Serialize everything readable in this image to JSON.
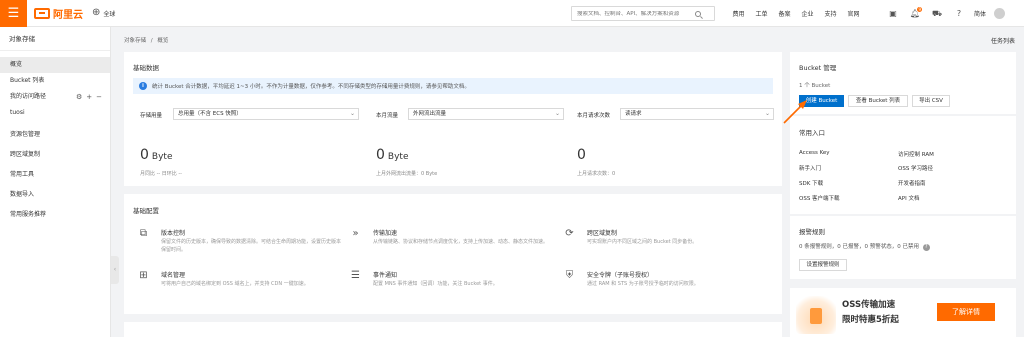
{
  "topbar": {
    "brand": "阿里云",
    "region": "全球",
    "search_placeholder": "搜索文档、控制台、API、解决方案和资源",
    "nav": [
      "费用",
      "工单",
      "备案",
      "企业",
      "支持",
      "官网"
    ],
    "notification_count": "9",
    "language": "简体"
  },
  "sidebar": {
    "title": "对象存储",
    "items": [
      {
        "label": "概览",
        "active": true
      },
      {
        "label": "Bucket 列表"
      },
      {
        "label": "我的访问路径"
      },
      {
        "label": "tuosi"
      },
      {
        "label": "资源包管理"
      },
      {
        "label": "跨区域复制"
      },
      {
        "label": "常用工具"
      },
      {
        "label": "数据导入"
      },
      {
        "label": "常用服务推荐"
      }
    ],
    "access_path_actions": [
      "⚙",
      "+",
      "−"
    ]
  },
  "breadcrumb": [
    "对象存储",
    "/",
    "概览"
  ],
  "task_list": "任务列表",
  "basic_data": {
    "title": "基础数据",
    "notice": "统计 Bucket 合计数据，平均延迟 1~3 小时。不作为计量数据，仅作参考。不同存储类型的存储用量计费规则，请参见帮助文档。",
    "metrics": [
      {
        "label": "存储用量",
        "select": "总用量（不含 ECS 快照）",
        "value": "0",
        "unit": "Byte",
        "sub": "月同比  --  日环比  --"
      },
      {
        "label": "本月流量",
        "select": "外网流出流量",
        "value": "0",
        "unit": "Byte",
        "sub": "上月外网流出流量：0 Byte"
      },
      {
        "label": "本月请求次数",
        "select": "读请求",
        "value": "0",
        "unit": "",
        "sub": "上月请求次数：0"
      }
    ]
  },
  "basic_config": {
    "title": "基础配置",
    "features": [
      {
        "icon": "version-control-icon",
        "glyph": "⧉",
        "title": "版本控制",
        "desc": "保留文件的历史版本，确保导致的数据清除。可结合生命周期功能，设置历史版本保留时间。"
      },
      {
        "icon": "transfer-acceleration-icon",
        "glyph": "»",
        "title": "传输加速",
        "desc": "从传输链路、协议和存储节点调度优化，支持上传加速、动态、静态文件加速。"
      },
      {
        "icon": "cross-region-replication-icon",
        "glyph": "⟳",
        "title": "跨区域复制",
        "desc": "可实现账户内不同区域之间的 Bucket 同步备份。"
      },
      {
        "icon": "domain-management-icon",
        "glyph": "⊞",
        "title": "域名管理",
        "desc": "可将用户自己的域名绑定到 OSS 域名上，并支持 CDN 一键加速。"
      },
      {
        "icon": "event-notification-icon",
        "glyph": "☰",
        "title": "事件通知",
        "desc": "配置 MNS 事件通知（回调）功能，关注 Bucket 事件。"
      },
      {
        "icon": "security-token-icon",
        "glyph": "⛨",
        "title": "安全令牌（子账号授权）",
        "desc": "通过 RAM 和 STS 为子账号授予临时的访问权限。"
      }
    ]
  },
  "bucket_mgmt": {
    "title": "Bucket 管理",
    "count": "1 个 Bucket",
    "buttons": [
      "创建 Bucket",
      "查看 Bucket 列表",
      "导出 CSV"
    ]
  },
  "quick_entry": {
    "title": "常用入口",
    "links": [
      "Access Key",
      "访问控制 RAM",
      "新手入门",
      "OSS 学习路径",
      "SDK 下载",
      "开发者指南",
      "OSS 客户端下载",
      "API 文档"
    ]
  },
  "alarm_rules": {
    "title": "报警规则",
    "summary": "0 条报警规则，0 已报警，0 预警状态，0 已禁用",
    "help": "?",
    "button": "设置报警规则"
  },
  "promo": {
    "line1": "OSS传输加速",
    "line2": "限时特惠5折起",
    "button": "了解详情"
  },
  "colors": {
    "brand": "#ff6a00",
    "primary": "#0070cc",
    "notice_bg": "#e9f3fe"
  }
}
